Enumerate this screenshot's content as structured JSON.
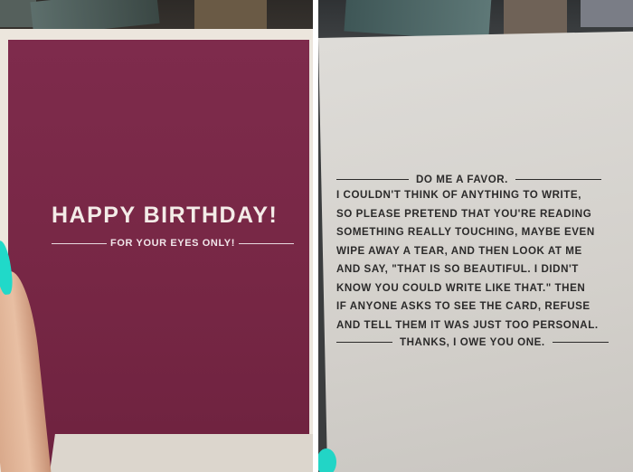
{
  "left_card": {
    "title": "HAPPY BIRTHDAY!",
    "subtitle": "FOR YOUR EYES ONLY!",
    "card_color": "#7a2947",
    "nail_color": "#20d9c9"
  },
  "right_card": {
    "header": "DO ME A FAVOR.",
    "lines": [
      "I COULDN'T THINK OF ANYTHING TO WRITE,",
      "SO PLEASE PRETEND THAT YOU'RE READING",
      "SOMETHING REALLY TOUCHING, MAYBE EVEN",
      "WIPE AWAY A TEAR, AND THEN LOOK AT ME",
      "AND SAY, \"THAT IS SO BEAUTIFUL. I DIDN'T",
      "KNOW YOU COULD WRITE LIKE THAT.\" THEN",
      "IF ANYONE ASKS TO SEE THE CARD, REFUSE",
      "AND TELL THEM IT WAS JUST TOO PERSONAL."
    ],
    "footer": "THANKS, I OWE YOU ONE.",
    "card_color": "#d6d3ce"
  }
}
